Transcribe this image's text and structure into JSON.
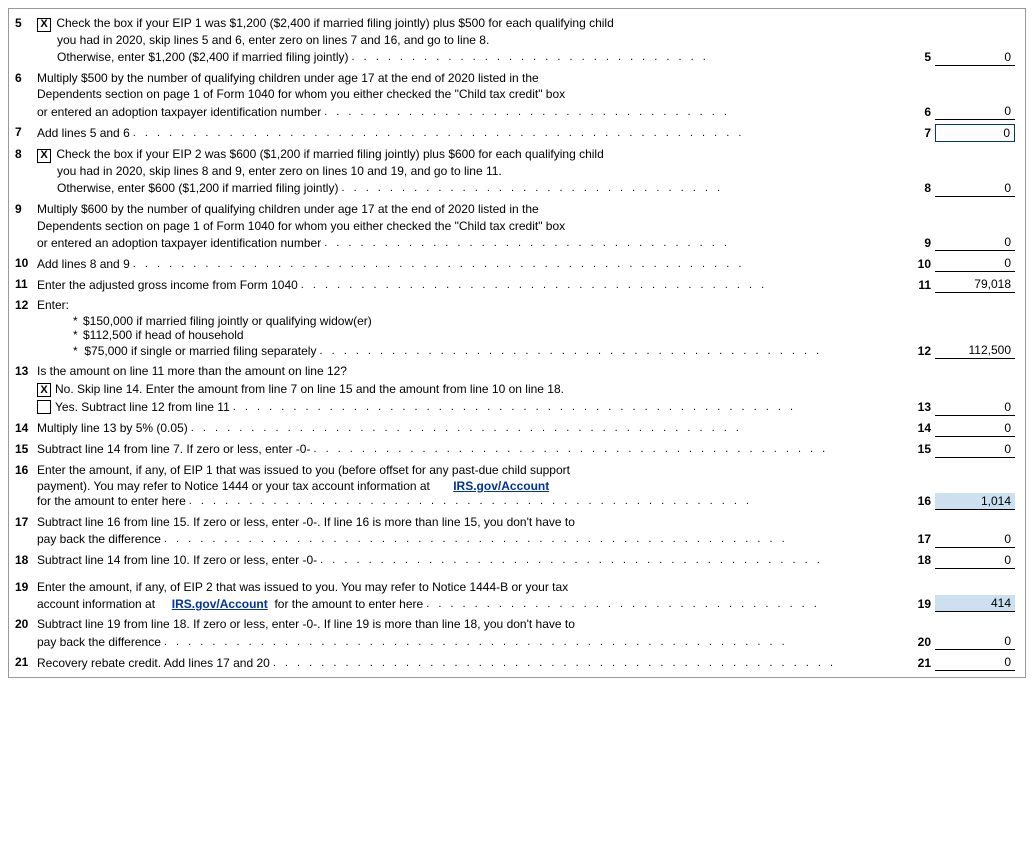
{
  "lines": [
    {
      "num": "5",
      "checkbox": true,
      "checked": true,
      "texts": [
        "Check the box if your EIP 1 was $1,200 ($2,400 if married filing jointly) plus $500 for each qualifying child",
        "you had in 2020, skip lines 5 and 6, enter zero on lines 7 and 16, and go to line 8.",
        "Otherwise, enter $1,200 ($2,400 if married filing jointly)"
      ],
      "field_num": "5",
      "field_value": "0",
      "highlighted": false,
      "outlined": false,
      "has_dots_last": true
    },
    {
      "num": "6",
      "checkbox": false,
      "texts": [
        "Multiply $500 by the number of qualifying children under age 17 at the end of 2020 listed in the",
        "Dependents section on page 1 of Form 1040 for whom you either checked the \"Child tax credit\" box",
        "or entered an adoption taxpayer identification number"
      ],
      "field_num": "6",
      "field_value": "0",
      "highlighted": false,
      "outlined": false,
      "has_dots_last": true
    },
    {
      "num": "7",
      "checkbox": false,
      "texts": [
        "Add lines 5 and 6"
      ],
      "field_num": "7",
      "field_value": "0",
      "highlighted": false,
      "outlined": true,
      "has_dots_last": true
    },
    {
      "num": "8",
      "checkbox": true,
      "checked": true,
      "texts": [
        "Check the box if your EIP 2 was $600 ($1,200 if married filing jointly) plus $600 for each qualifying child",
        "you had in 2020, skip lines 8 and 9, enter zero on lines 10 and 19, and go to line 11.",
        "Otherwise, enter $600 ($1,200 if married filing jointly)"
      ],
      "field_num": "8",
      "field_value": "0",
      "highlighted": false,
      "outlined": false,
      "has_dots_last": true
    },
    {
      "num": "9",
      "checkbox": false,
      "texts": [
        "Multiply $600 by the number of qualifying children under age 17 at the end of 2020 listed in the",
        "Dependents section on page 1 of Form 1040 for whom you either checked the \"Child tax credit\" box",
        "or entered an adoption taxpayer identification number"
      ],
      "field_num": "9",
      "field_value": "0",
      "highlighted": false,
      "outlined": false,
      "has_dots_last": true
    },
    {
      "num": "10",
      "checkbox": false,
      "texts": [
        "Add lines 8 and 9"
      ],
      "field_num": "10",
      "field_value": "0",
      "highlighted": false,
      "outlined": false,
      "has_dots_last": true
    },
    {
      "num": "11",
      "checkbox": false,
      "texts": [
        "Enter the adjusted gross income from Form 1040"
      ],
      "field_num": "11",
      "field_value": "79,018",
      "highlighted": false,
      "outlined": false,
      "has_dots_last": true
    }
  ],
  "line12": {
    "num": "12",
    "label": "Enter:",
    "bullets": [
      "$150,000 if married filing jointly or qualifying widow(er)",
      "$112,500 if head of household",
      "$75,000 if single or married filing separately"
    ],
    "field_num": "12",
    "field_value": "112,500"
  },
  "line13": {
    "num": "13",
    "label": "Is the amount on line 11 more than the amount on line 12?",
    "no_checkbox": true,
    "no_checked": true,
    "no_text": "No. Skip line 14. Enter the amount from line 7 on line 15 and the amount from line 10 on line 18.",
    "yes_checkbox": false,
    "yes_text": "Yes. Subtract line 12 from line 11",
    "field_num": "13",
    "field_value": "0"
  },
  "line14": {
    "num": "14",
    "label": "Multiply line 13 by 5% (0.05)",
    "field_num": "14",
    "field_value": "0"
  },
  "line15": {
    "num": "15",
    "label": "Subtract line 14 from line 7. If zero or less, enter  -0-",
    "field_num": "15",
    "field_value": "0"
  },
  "line16": {
    "num": "16",
    "texts": [
      "Enter the amount, if any, of EIP 1 that was issued to you (before offset for any past-due child support",
      "payment). You may refer to Notice 1444 or your tax account information at"
    ],
    "link_text": "IRS.gov/Account",
    "texts2": [
      "for the amount to enter here"
    ],
    "field_num": "16",
    "field_value": "1,014",
    "highlighted": true
  },
  "line17": {
    "num": "17",
    "texts": [
      "Subtract line 16 from line 15. If zero or less, enter -0-. If line 16 is more than line 15, you don't have to",
      "pay back the difference"
    ],
    "field_num": "17",
    "field_value": "0"
  },
  "line18": {
    "num": "18",
    "label": "Subtract line 14 from line 10. If zero or less, enter -0-",
    "field_num": "18",
    "field_value": "0"
  },
  "line19": {
    "num": "19",
    "texts": [
      "Enter the amount, if any, of EIP 2 that was issued to you. You may refer to Notice 1444-B or your tax",
      "account information at"
    ],
    "link_text": "IRS.gov/Account",
    "texts2": [
      "for the amount to enter here"
    ],
    "field_num": "19",
    "field_value": "414",
    "highlighted": true
  },
  "line20": {
    "num": "20",
    "texts": [
      "Subtract line 19 from line 18. If zero or less, enter -0-. If line 19 is more than line 18, you don't have to",
      "pay back the difference"
    ],
    "field_num": "20",
    "field_value": "0"
  },
  "line21": {
    "num": "21",
    "label": "Recovery rebate credit. Add lines 17 and 20",
    "field_num": "21",
    "field_value": "0"
  }
}
